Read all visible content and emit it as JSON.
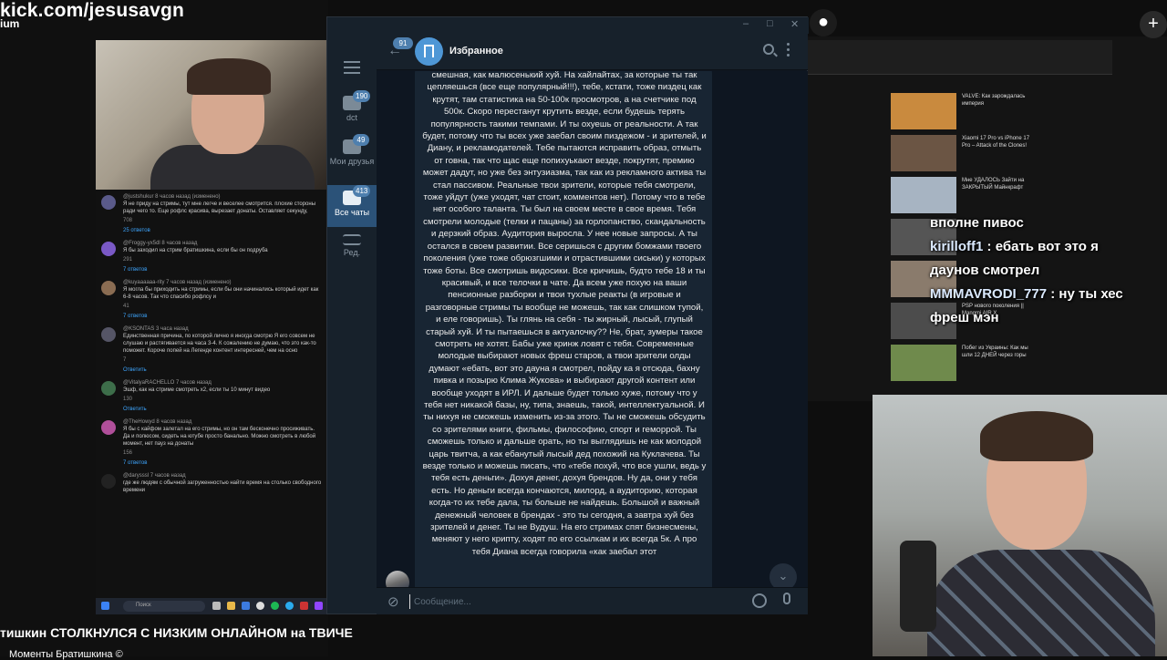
{
  "stream": {
    "url": "kick.com/jesusavgn",
    "sub": "ium",
    "video_title": "тишкин СТОЛКНУЛСЯ С НИЗКИМ ОНЛАЙНОМ на ТВИЧЕ",
    "channel": "Моменты Братишкина ©"
  },
  "comments": [
    {
      "name": "@justshukur 8 часов назад (изменено)",
      "text": "Я не приду на стримы, тут мне легче и веселее смотрится. плохие стороны ради чего то. Еще рофлс красива, вырезает донаты. Оставляет секунду,",
      "likes": "708",
      "replies": "25 ответов"
    },
    {
      "name": "@Froggy-yx5dl 8 часов назад",
      "text": "Я бы заходил на стрим братишкина, если бы он подруба",
      "likes": "291",
      "replies": "7 ответов"
    },
    {
      "name": "@kuyaaaaaa-rity 7 часов назад (изменено)",
      "text": "Я могла бы приходить на стримы, если бы они начинались который идет как 6-8 часов. Так что спасибо рофлсу и",
      "likes": "41",
      "replies": "7 ответов"
    },
    {
      "name": "@KSONTAS 3 часа назад",
      "text": "Единственная причина, по которой лично я иногда смотрю Я его совсем не слушаю и растягивается на часа 3-4. К сожалению не думаю, что это как-то поможет. Короче попей на Легенде контент интересней, чем на осно",
      "likes": "7",
      "replies": "Ответить"
    },
    {
      "name": "@VitalyaRACHELLO 7 часов назад",
      "text": "Эшф, как на стриме смотреть x2, если ты 10 минут видео",
      "likes": "130",
      "replies": "Ответить"
    },
    {
      "name": "@TheHowyd 8 часов назад",
      "text": "Я бы с кайфом залетал на его стримы, но он там бесконечно просиживать. Да и полюсом, сидеть на ютубе просто банально. Можно смотреть в любой момент, нет пауз на донаты",
      "likes": "156",
      "replies": "7 ответов"
    },
    {
      "name": "@darysssl 7 часов назад",
      "text": "где же людям с обычной загруженностью найти время на столько свободного времени",
      "likes": "",
      "replies": ""
    }
  ],
  "taskbar": {
    "search": "Поиск"
  },
  "recs": [
    {
      "title": "VALVE: Как зарождалась империя"
    },
    {
      "title": "Xiaomi 17 Pro vs iPhone 17 Pro – Attack of the Clones!"
    },
    {
      "title": "Мне УДАЛОСЬ Зайти на ЗАКРЫТЫЙ Майнкрафт"
    },
    {
      "title": ""
    },
    {
      "title": ""
    },
    {
      "title": "PSP нового поколения || Mangmi AIR X"
    },
    {
      "title": "Побег из Украины: Как мы шли 12 ДНЕЙ через горы"
    }
  ],
  "chat_overlay": [
    {
      "user": "",
      "text": "вполне пивос"
    },
    {
      "user": "kirilloff1",
      "text": ": ебать вот это я даунов смотрел"
    },
    {
      "user": "MMMAVRODI_777",
      "text": ": ну ты хес фреш мэн"
    }
  ],
  "telegram": {
    "chat_title": "Избранное",
    "back_badge": "91",
    "folders": [
      {
        "label": "dct",
        "badge": "190"
      },
      {
        "label": "Мои друзья",
        "badge": "49"
      },
      {
        "label": "Все чаты",
        "badge": "413"
      },
      {
        "label": "Ред.",
        "badge": ""
      }
    ],
    "input_placeholder": "Сообщение...",
    "message": "смешная, как малюсенький хуй. На хайлайтах, за которые ты так цепляешься (все еще популярный!!!), тебе, кстати, тоже пиздец как крутят, там статистика на 50-100к просмотров, а на счетчике под 500к. Скоро перестанут крутить везде, если будешь терять популярность такими темпами. И ты охуешь от реальности. А так будет, потому что ты всех уже заебал своим пиздежом - и зрителей, и Диану, и рекламодателей. Тебе пытаются исправить образ, отмыть от говна, так что щас еще попихуькают везде, покрутят, премию может дадут, но уже без энтузиазма, так как из рекламного актива ты стал пассивом. Реальные твои зрители, которые тебя смотрели, тоже уйдут (уже уходят, чат стоит, комментов нет). Потому что в тебе нет особого таланта. Ты был на своем месте в свое время.  Тебя смотрели молодые (телки и пацаны) за горлопанство, скандальность и дерзкий образ. Аудитория выросла. У нее новые запросы. А ты остался в своем развитии. Все серишься с другим бомжами твоего поколения (уже тоже обрюзгшими и отрастившими сиськи) у которых тоже боты. Все смотришь видосики. Все кричишь, будто тебе 18 и ты красивый, и все телочки в чате. Да всем уже похую на ваши пенсионные разборки и твои тухлые реакты (в игровые и разговорные стримы ты вообще не можешь, так как слишком тупой, и еле говоришь). Ты глянь на себя - ты жирный, лысый, глупый старый хуй. И ты пытаешься в актуалочку?? Не, брат, зумеры такое смотреть не хотят. Бабы уже кринж ловят с тебя. Современные молодые выбирают новых фреш старов, а твои зрители олды думают «ебать, вот это дауна я смотрел, пойду ка я отсюда, бахну пивка и позырю Клима Жукова» и выбирают другой контент или вообще уходят в ИРЛ. И дальше будет только хуже, потому что у тебя нет никакой базы, ну, типа, знаешь, такой, интеллектуальной.  И ты нихуя не сможешь изменить из-за этого. Ты не сможешь обсудить со зрителями книги, фильмы, философию, спорт и геморрой. Ты сможешь только и дальше орать, но ты выглядишь не как молодой царь твитча, а как ебанутый лысый дед похожий на Куклачева. Ты везде только и можешь писать, что «тебе похуй, что все ушли, ведь у тебя есть деньги». Дохуя денег, дохуя брендов. Ну да, они у тебя есть. Но деньги всегда кончаются, милорд, а аудиторию, которая когда-то их тебе дала, ты больше не найдешь. Большой и важный денежный человек в брендах - это ты сегодня, а завтра хуй без зрителей и денег. Ты не Вудуш. На его стримах спят бизнесмены, меняют у него крипту, ходят по его ссылкам и их всегда 5к. А про тебя Диана всегда говорила «как заебал этот"
  }
}
